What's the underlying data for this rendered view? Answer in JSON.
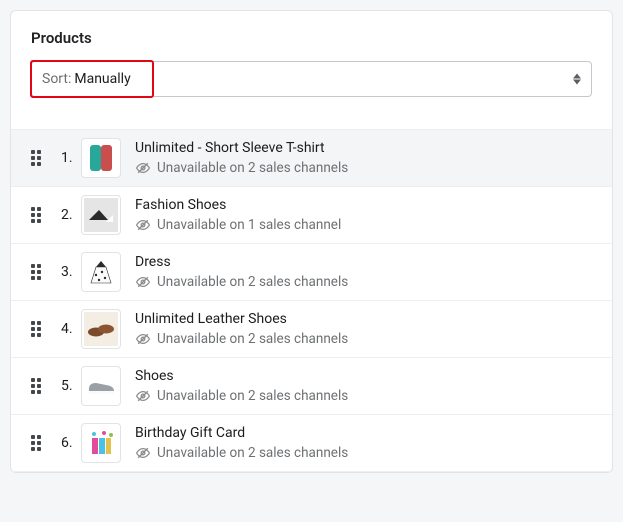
{
  "section_title": "Products",
  "sort": {
    "label": "Sort:",
    "value": "Manually"
  },
  "products": [
    {
      "num": "1.",
      "title": "Unlimited - Short Sleeve T-shirt",
      "status": "Unavailable on 2 sales channels"
    },
    {
      "num": "2.",
      "title": "Fashion Shoes",
      "status": "Unavailable on 1 sales channel"
    },
    {
      "num": "3.",
      "title": "Dress",
      "status": "Unavailable on 2 sales channels"
    },
    {
      "num": "4.",
      "title": "Unlimited Leather Shoes",
      "status": "Unavailable on 2 sales channels"
    },
    {
      "num": "5.",
      "title": "Shoes",
      "status": "Unavailable on 2 sales channels"
    },
    {
      "num": "6.",
      "title": "Birthday Gift Card",
      "status": "Unavailable on 2 sales channels"
    }
  ]
}
